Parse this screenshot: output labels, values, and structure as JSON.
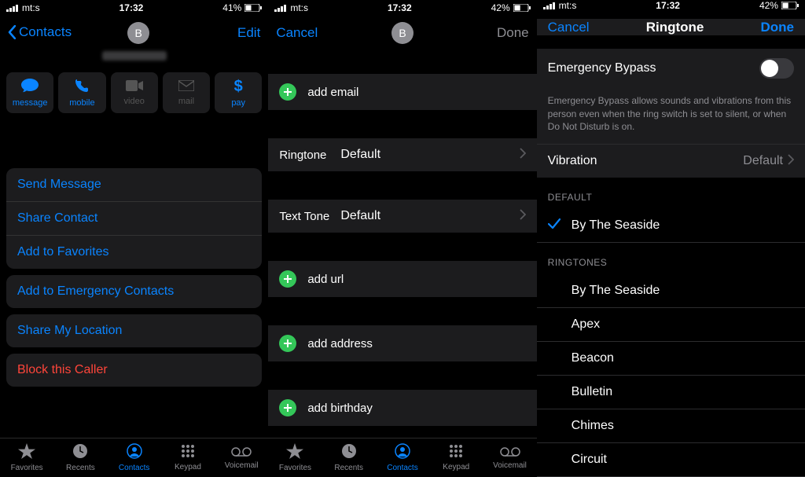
{
  "status": {
    "carrier": "mt:s",
    "time": "17:32",
    "battery1": "41%",
    "battery2": "42%",
    "battery3": "42%"
  },
  "col1": {
    "back": "Contacts",
    "edit": "Edit",
    "avatar_initial": "B",
    "quick": {
      "message": "message",
      "mobile": "mobile",
      "video": "video",
      "mail": "mail",
      "pay": "pay"
    },
    "actions": {
      "send": "Send Message",
      "share": "Share Contact",
      "addfav": "Add to Favorites",
      "addem": "Add to Emergency Contacts",
      "shareloc": "Share My Location",
      "block": "Block this Caller"
    },
    "tabs": {
      "favorites": "Favorites",
      "recents": "Recents",
      "contacts": "Contacts",
      "keypad": "Keypad",
      "voicemail": "Voicemail"
    }
  },
  "col2": {
    "cancel": "Cancel",
    "done": "Done",
    "avatar_initial": "B",
    "add_email": "add email",
    "ringtone_label": "Ringtone",
    "ringtone_value": "Default",
    "texttone_label": "Text Tone",
    "texttone_value": "Default",
    "add_url": "add url",
    "add_address": "add address",
    "add_birthday": "add birthday"
  },
  "col3": {
    "cancel": "Cancel",
    "title": "Ringtone",
    "done": "Done",
    "eb_label": "Emergency Bypass",
    "eb_desc": "Emergency Bypass allows sounds and vibrations from this person even when the ring switch is set to silent, or when Do Not Disturb is on.",
    "vibration_label": "Vibration",
    "vibration_value": "Default",
    "default_hdr": "DEFAULT",
    "default_sel": "By The Seaside",
    "ringtones_hdr": "RINGTONES",
    "ringtones": [
      "By The Seaside",
      "Apex",
      "Beacon",
      "Bulletin",
      "Chimes",
      "Circuit"
    ]
  }
}
